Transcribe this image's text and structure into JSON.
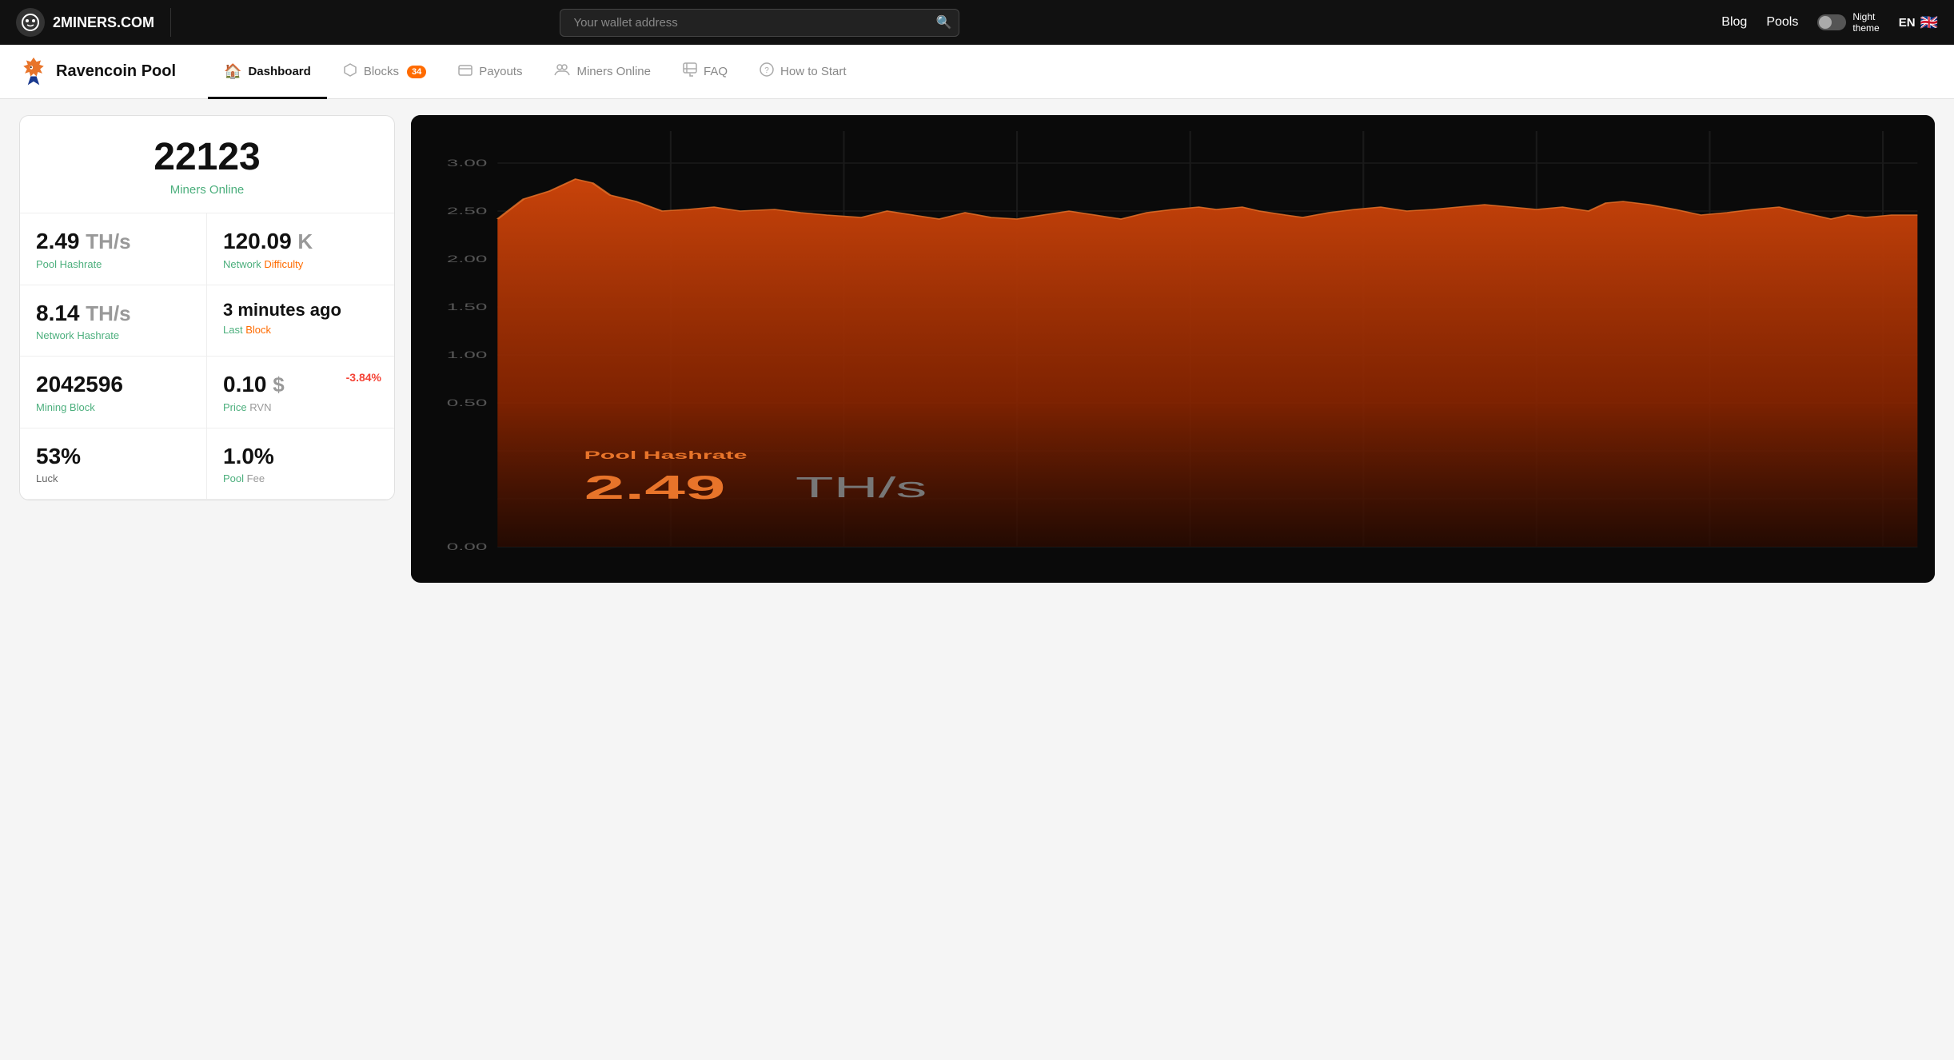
{
  "topNav": {
    "logoText": "2MINERS.COM",
    "searchPlaceholder": "Your wallet address",
    "blogLabel": "Blog",
    "poolsLabel": "Pools",
    "nightThemeLabel": "Night\ntheme",
    "langLabel": "EN"
  },
  "subNav": {
    "poolTitle": "Ravencoin Pool",
    "tabs": [
      {
        "id": "dashboard",
        "label": "Dashboard",
        "icon": "🏠",
        "active": true,
        "badge": null
      },
      {
        "id": "blocks",
        "label": "Blocks",
        "icon": "⬡",
        "active": false,
        "badge": "34"
      },
      {
        "id": "payouts",
        "label": "Payouts",
        "icon": "💳",
        "active": false,
        "badge": null
      },
      {
        "id": "miners",
        "label": "Miners Online",
        "icon": "👥",
        "active": false,
        "badge": null
      },
      {
        "id": "faq",
        "label": "FAQ",
        "icon": "💬",
        "active": false,
        "badge": null
      },
      {
        "id": "howtostart",
        "label": "How to Start",
        "icon": "❓",
        "active": false,
        "badge": null
      }
    ]
  },
  "stats": {
    "minersOnline": {
      "count": "22123",
      "labelPrefix": "Miners",
      "labelSuffix": "Online"
    },
    "poolHashrate": {
      "value": "2.49",
      "unit": "TH/s",
      "label": "Pool",
      "labelSuffix": "Hashrate"
    },
    "networkDifficulty": {
      "value": "120.09",
      "unit": "K",
      "label": "Network",
      "labelSuffix": "Difficulty"
    },
    "networkHashrate": {
      "value": "8.14",
      "unit": "TH/s",
      "label": "Network",
      "labelSuffix": "Hashrate"
    },
    "lastBlock": {
      "value": "3 minutes ago",
      "label": "Last",
      "labelSuffix": "Block"
    },
    "miningBlock": {
      "value": "2042596",
      "label": "Mining",
      "labelSuffix": "Block"
    },
    "price": {
      "value": "0.10",
      "unit": "$",
      "label": "Price",
      "labelSuffix": "RVN",
      "change": "-3.84%"
    },
    "luck": {
      "value": "53%",
      "label": "Luck"
    },
    "poolFee": {
      "value": "1.0%",
      "label": "Pool",
      "labelSuffix": "Fee"
    }
  },
  "chart": {
    "title": "Pool Hashrate",
    "currentValue": "2.49",
    "currentUnit": "TH/s",
    "yLabels": [
      "3.00",
      "2.50",
      "2.00",
      "1.50",
      "1.00",
      "0.50",
      "0.00"
    ]
  }
}
